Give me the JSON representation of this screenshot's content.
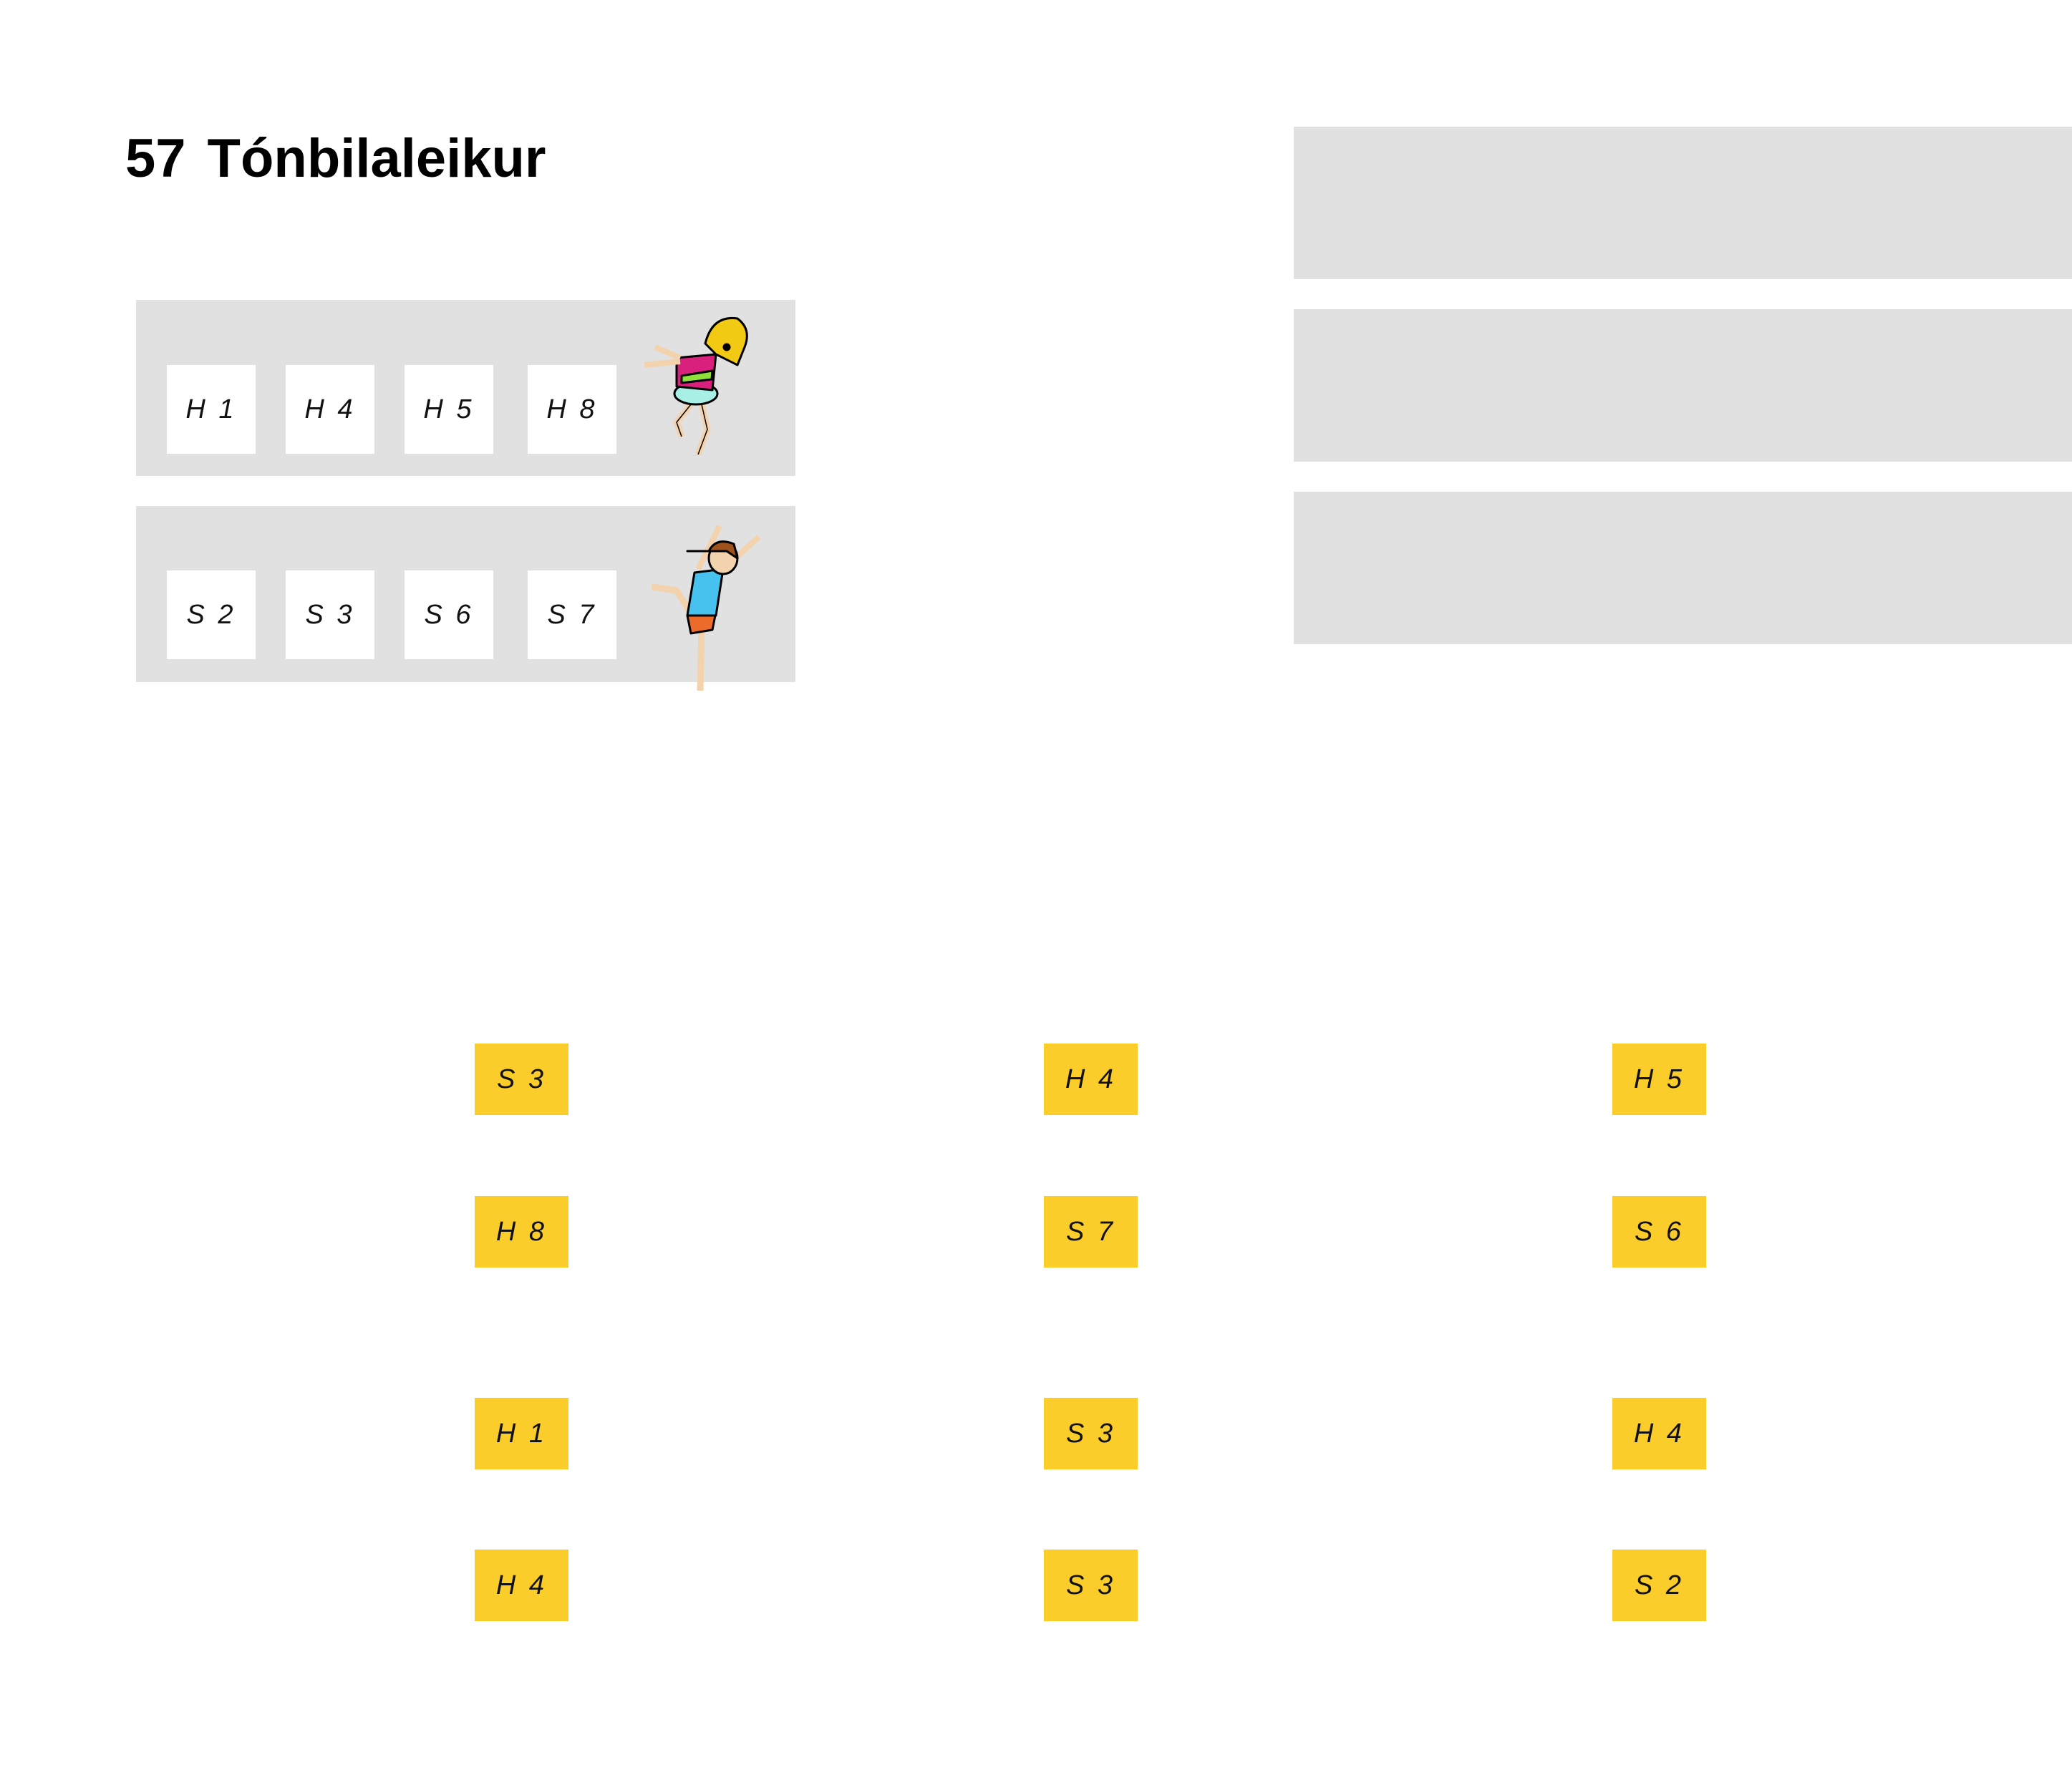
{
  "header": {
    "number": "57",
    "title": "Tónbilaleikur"
  },
  "rows": [
    {
      "cards": [
        "H 1",
        "H 4",
        "H 5",
        "H 8"
      ],
      "illustration": "jumping-girl-blonde-icon"
    },
    {
      "cards": [
        "S 2",
        "S 3",
        "S 6",
        "S 7"
      ],
      "illustration": "dancing-girl-brown-icon"
    }
  ],
  "answer_bars": 3,
  "yellow_cards": [
    [
      "S 3",
      "H 4",
      "H 5"
    ],
    [
      "H 8",
      "S 7",
      "S 6"
    ],
    [
      "H 1",
      "S 3",
      "H 4"
    ],
    [
      "H 4",
      "S 3",
      "S 2"
    ]
  ],
  "colors": {
    "panel": "#e1e1e1",
    "card": "#ffffff",
    "yellow": "#fbcd2a"
  }
}
